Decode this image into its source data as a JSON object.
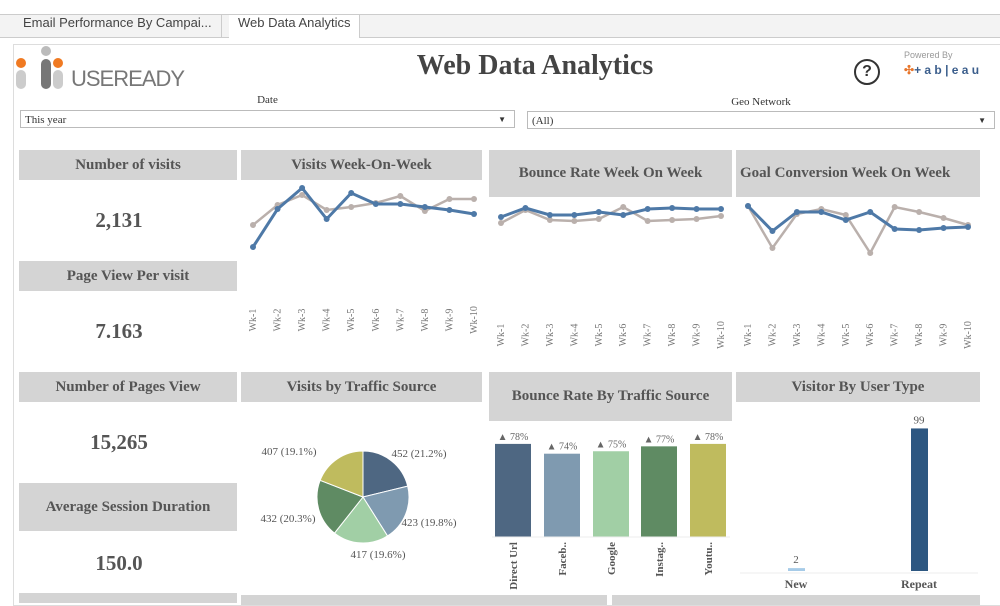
{
  "tabs": [
    {
      "label": "Email Performance By Campai..."
    },
    {
      "label": "Web Data Analytics"
    }
  ],
  "header": {
    "title": "Web Data Analytics",
    "logo_text": "USEREADY",
    "powered_by": "Powered By",
    "tableau_text": "+ a b | e a u",
    "help_icon": "question-circle-icon"
  },
  "filters": {
    "date": {
      "label": "Date",
      "value": "This year"
    },
    "geo": {
      "label": "Geo Network",
      "value": "(All)"
    }
  },
  "kpis": [
    {
      "title": "Number of visits",
      "value": "2,131"
    },
    {
      "title": "Page View Per visit",
      "value": "7.163"
    },
    {
      "title": "Number of Pages View",
      "value": "15,265"
    },
    {
      "title": "Average Session Duration",
      "value": "150.0"
    }
  ],
  "colors": {
    "current": "#4e79a7",
    "previous": "#bab0ac",
    "header_bg": "#d4d4d4"
  },
  "chart_data": [
    {
      "type": "line",
      "title": "Visits Week-On-Week",
      "categories": [
        "Wk-1",
        "Wk-2",
        "Wk-3",
        "Wk-4",
        "Wk-5",
        "Wk-6",
        "Wk-7",
        "Wk-8",
        "Wk-9",
        "Wk-10"
      ],
      "series": [
        {
          "values": [
            13,
            51,
            72,
            41,
            67,
            56,
            56,
            53,
            50,
            46
          ],
          "color": "#4e79a7"
        },
        {
          "values": [
            35,
            55,
            65,
            50,
            53,
            57,
            64,
            49,
            61,
            61
          ],
          "color": "#bab0ac"
        }
      ]
    },
    {
      "type": "line",
      "title": "Bounce Rate Week On Week",
      "categories": [
        "Wk-1",
        "Wk-2",
        "Wk-3",
        "Wk-4",
        "Wk-5",
        "Wk-6",
        "Wk-7",
        "Wk-8",
        "Wk-9",
        "Wk-10"
      ],
      "series": [
        {
          "values": [
            43,
            52,
            45,
            45,
            48,
            45,
            51,
            52,
            51,
            51
          ],
          "color": "#4e79a7"
        },
        {
          "values": [
            37,
            50,
            40,
            39,
            41,
            53,
            39,
            40,
            41,
            44
          ],
          "color": "#bab0ac"
        }
      ]
    },
    {
      "type": "line",
      "title": "Goal Conversion Week On Week",
      "categories": [
        "Wk-1",
        "Wk-2",
        "Wk-3",
        "Wk-4",
        "Wk-5",
        "Wk-6",
        "Wk-7",
        "Wk-8",
        "Wk-9",
        "Wk-10"
      ],
      "series": [
        {
          "values": [
            54,
            29,
            48,
            48,
            40,
            48,
            31,
            30,
            32,
            33
          ],
          "color": "#4e79a7"
        },
        {
          "values": [
            54,
            12,
            46,
            51,
            45,
            7,
            53,
            48,
            42,
            35
          ],
          "color": "#bab0ac"
        }
      ]
    },
    {
      "type": "pie",
      "title": "Visits by Traffic Source",
      "slices": [
        {
          "value": 452,
          "label": "452 (21.2%)",
          "color": "#4e6782"
        },
        {
          "value": 423,
          "label": "423 (19.8%)",
          "color": "#7f9ab0"
        },
        {
          "value": 417,
          "label": "417 (19.6%)",
          "color": "#a1cfa5"
        },
        {
          "value": 432,
          "label": "432 (20.3%)",
          "color": "#5f8b63"
        },
        {
          "value": 407,
          "label": "407 (19.1%)",
          "color": "#bfbb5e"
        }
      ]
    },
    {
      "type": "bar",
      "title": "Bounce Rate By Traffic Source",
      "categories": [
        "Direct Url",
        "Faceb..",
        "Google",
        "Instag..",
        "Youtu.."
      ],
      "values": [
        78,
        74,
        75,
        77,
        78
      ],
      "labels": [
        "▲ 78%",
        "▲ 74%",
        "▲ 75%",
        "▲ 77%",
        "▲ 78%"
      ],
      "colors": [
        "#4e6782",
        "#7f9ab0",
        "#a1cfa5",
        "#5f8b63",
        "#bfbb5e"
      ]
    },
    {
      "type": "bar",
      "title": "Visitor By User Type",
      "categories": [
        "New",
        "Repeat"
      ],
      "values": [
        2,
        99
      ],
      "colors": [
        "#a6cbe8",
        "#2d5781"
      ]
    }
  ]
}
